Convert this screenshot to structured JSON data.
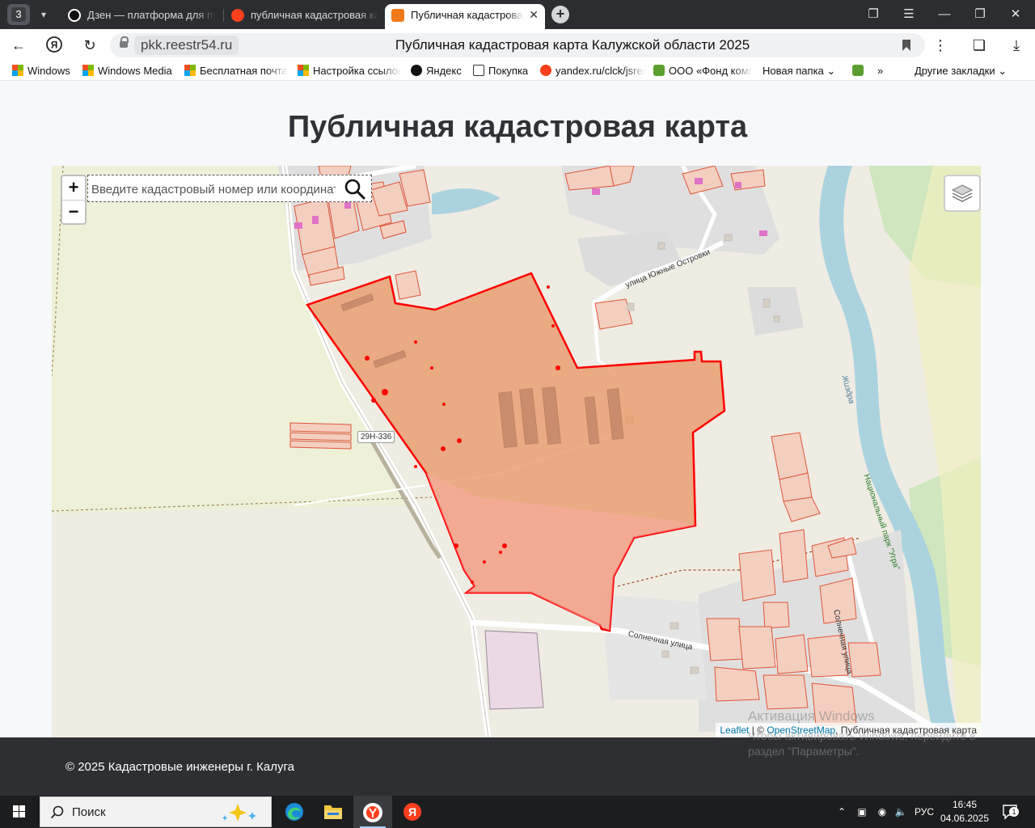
{
  "browser": {
    "tab_count": "3",
    "tabs": [
      {
        "label": "Дзен — платформа для публикации"
      },
      {
        "label": "публичная кадастровая карта"
      },
      {
        "label": "Публичная кадастровая карта"
      }
    ],
    "address": {
      "domain": "pkk.reestr54.ru",
      "title": "Публичная кадастровая карта Калужской области 2025"
    },
    "bookmarks": [
      {
        "label": "Windows",
        "icon": "windows-icon"
      },
      {
        "label": "Windows Media",
        "icon": "windows-icon"
      },
      {
        "label": "Бесплатная почта",
        "icon": "windows-icon"
      },
      {
        "label": "Настройка ссылок",
        "icon": "windows-icon"
      },
      {
        "label": "Яндекс",
        "icon": "yandex-icon"
      },
      {
        "label": "Покупка",
        "icon": "shopping-icon"
      },
      {
        "label": "yandex.ru/clck/jsredir",
        "icon": "yandex-icon"
      },
      {
        "label": "ООО «Фонд комплексного",
        "icon": "fund-icon"
      },
      {
        "label": "Новая папка",
        "icon": "folder-icon"
      },
      {
        "label": "»",
        "icon": "overflow-icon"
      },
      {
        "label": "Другие закладки",
        "icon": "folder-icon"
      }
    ]
  },
  "page": {
    "title": "Публичная кадастровая карта",
    "search": {
      "placeholder": "Введите кадастровый номер или координаты"
    },
    "zoom": {
      "in": "+",
      "out": "−"
    },
    "map_labels": {
      "street_1": "улица Южные Островки",
      "street_2": "Солнечная улица",
      "street_3": "Солнечная улица",
      "road_shield": "29Н-336",
      "river": "Жиздра",
      "park": "Национальный парк \"Угра\""
    },
    "attribution": {
      "leaflet": "Leaflet",
      "sep": " | © ",
      "osm": "OpenStreetMap",
      "rest": ", Публичная кадастровая карта"
    },
    "footer": "© 2025 Кадастровые инженеры г. Калуга"
  },
  "watermark": {
    "line1": "Активация Windows",
    "line2": "Чтобы активировать Windows, перейдите в",
    "line3": "раздел \"Параметры\"."
  },
  "taskbar": {
    "search_placeholder": "Поиск",
    "lang": "РУС",
    "time": "16:45",
    "date": "04.06.2025",
    "notifications": "1"
  },
  "colors": {
    "accent_red": "#ff0000",
    "plot_fill": "#e89a6a",
    "river": "#aad3df",
    "forest": "#add19e"
  }
}
